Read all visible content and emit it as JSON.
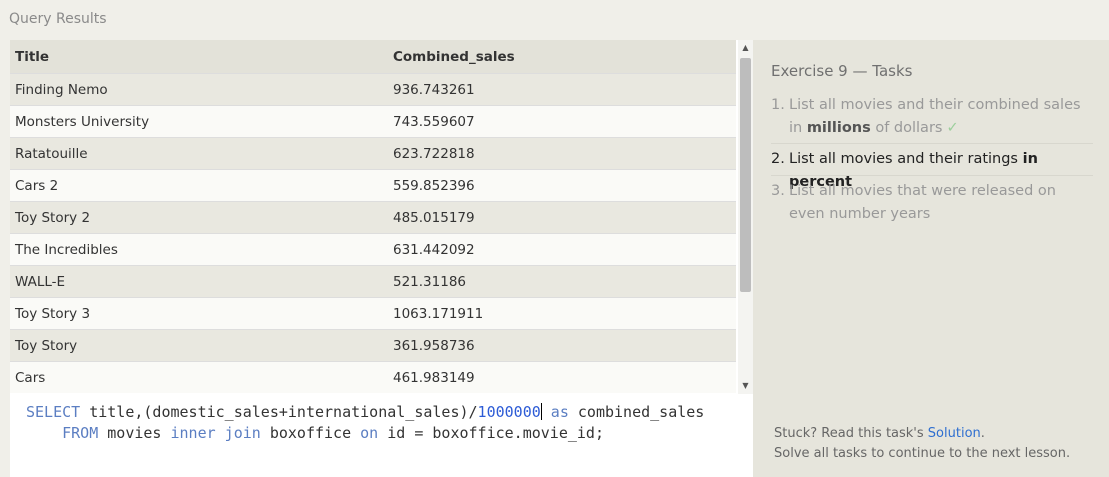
{
  "query_results": {
    "title": "Query Results",
    "columns": [
      "Title",
      "Combined_sales"
    ],
    "rows": [
      [
        "Finding Nemo",
        "936.743261"
      ],
      [
        "Monsters University",
        "743.559607"
      ],
      [
        "Ratatouille",
        "623.722818"
      ],
      [
        "Cars 2",
        "559.852396"
      ],
      [
        "Toy Story 2",
        "485.015179"
      ],
      [
        "The Incredibles",
        "631.442092"
      ],
      [
        "WALL-E",
        "521.31186"
      ],
      [
        "Toy Story 3",
        "1063.171911"
      ],
      [
        "Toy Story",
        "361.958736"
      ],
      [
        "Cars",
        "461.983149"
      ]
    ]
  },
  "editor": {
    "line1": {
      "kw_select": "SELECT",
      "expr": " title,(domestic_sales+international_sales)/",
      "number": "1000000",
      "kw_as": " as",
      "alias": " combined_sales"
    },
    "line2": {
      "kw_from": "FROM",
      "table1": " movies ",
      "kw_join": "inner join",
      "table2": " boxoffice ",
      "kw_on": "on",
      "cond": " id = boxoffice.movie_id;"
    }
  },
  "exercise": {
    "title": "Exercise 9 — Tasks",
    "tasks": [
      {
        "num": "1.",
        "pre": "List all movies and their combined sales in ",
        "bold": "millions",
        "post": " of dollars",
        "check": "✓"
      },
      {
        "num": "2.",
        "pre": "List all movies and their ratings ",
        "bold": "in percent",
        "post": ""
      },
      {
        "num": "3.",
        "text": "List all movies that were released on even number years"
      }
    ]
  },
  "footer": {
    "stuck_pre": "Stuck? Read this task's ",
    "solution_link": "Solution",
    "stuck_post": ".",
    "solve_all": "Solve all tasks to continue to the next lesson."
  }
}
